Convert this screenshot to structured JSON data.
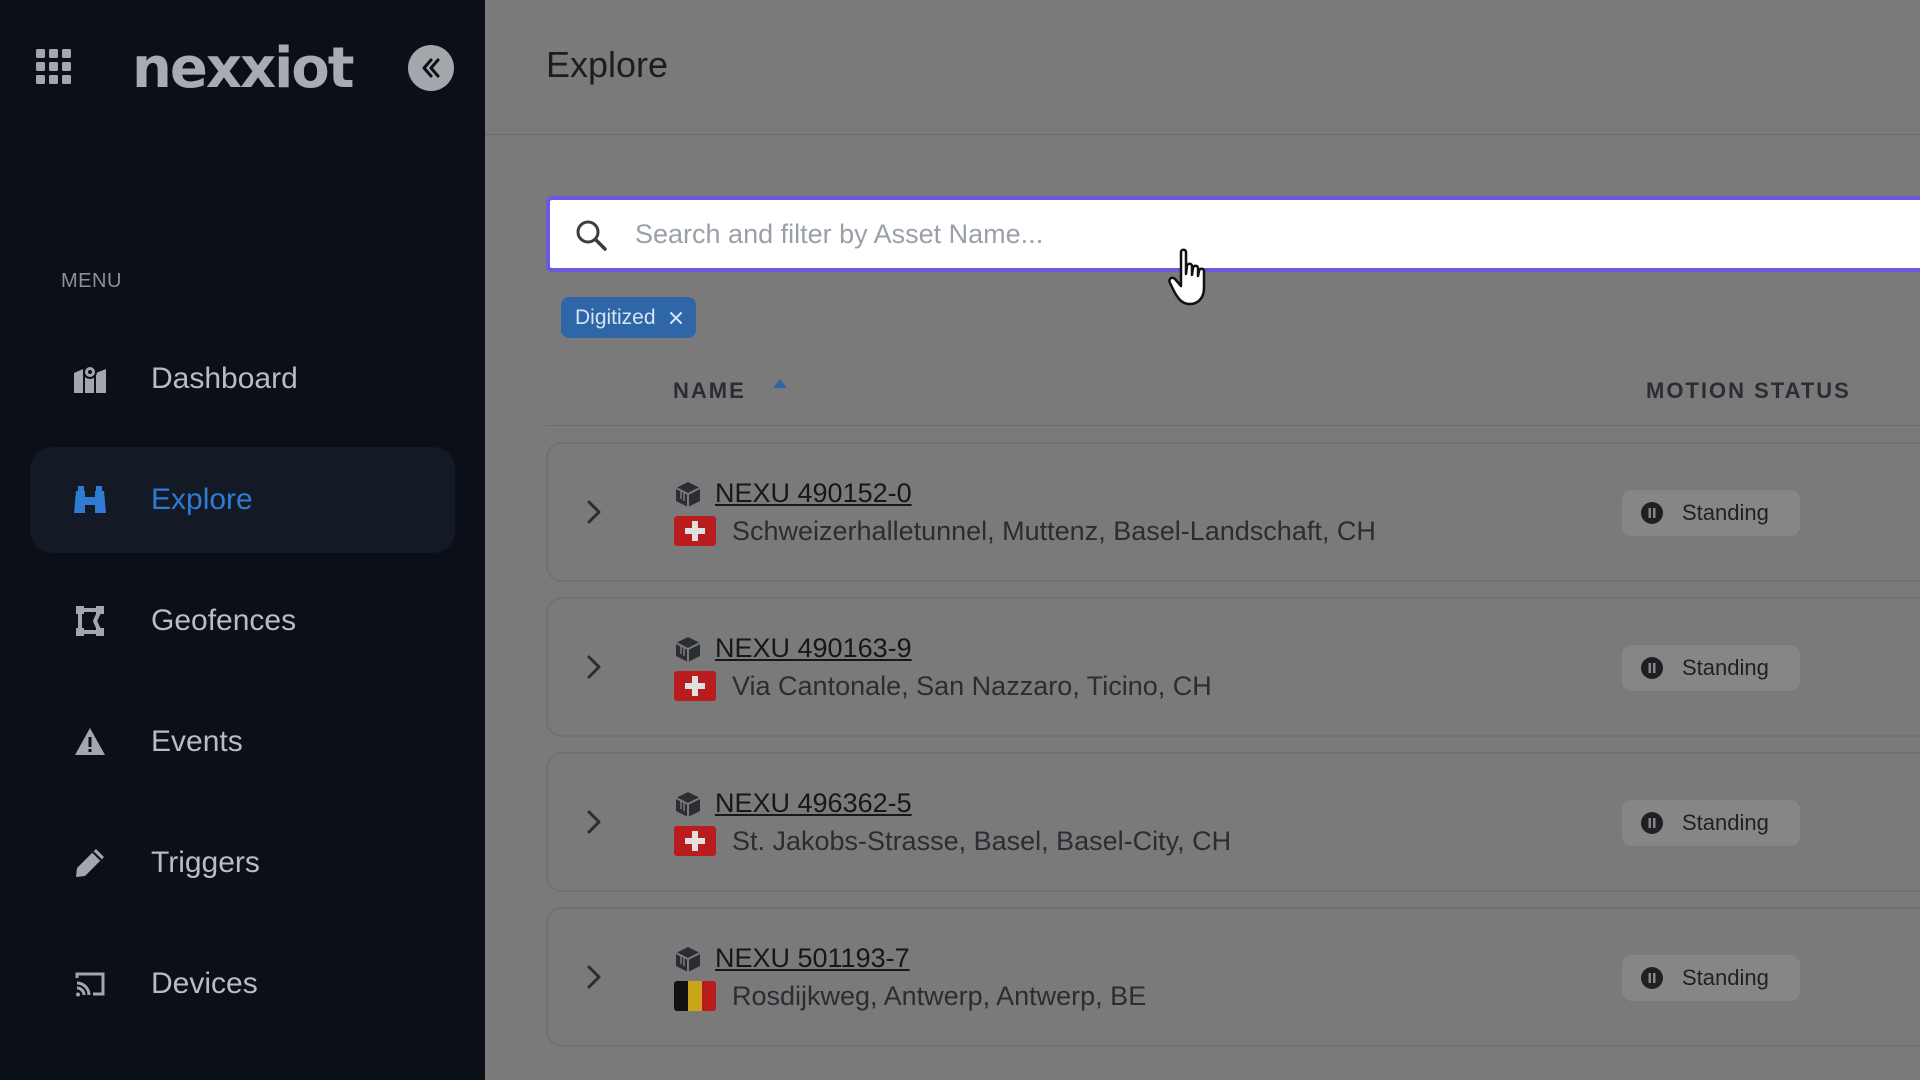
{
  "sidebar": {
    "logo_text": "nexxiot",
    "menu_label": "MENU",
    "items": [
      {
        "label": "Dashboard",
        "icon": "map-icon"
      },
      {
        "label": "Explore",
        "icon": "binoculars-icon",
        "active": true
      },
      {
        "label": "Geofences",
        "icon": "geofence-icon"
      },
      {
        "label": "Events",
        "icon": "warning-icon"
      },
      {
        "label": "Triggers",
        "icon": "pencil-icon"
      },
      {
        "label": "Devices",
        "icon": "cast-icon"
      }
    ]
  },
  "header": {
    "title": "Explore"
  },
  "search": {
    "placeholder": "Search and filter by Asset Name...",
    "value": ""
  },
  "filters": [
    {
      "label": "Digitized"
    }
  ],
  "table": {
    "columns": {
      "name": "NAME",
      "motion_status": "MOTION STATUS"
    },
    "sort": "ascending",
    "rows": [
      {
        "name": "NEXU 490152-0",
        "location": "Schweizerhalletunnel, Muttenz, Basel-Landschaft, CH",
        "country": "CH",
        "status": "Standing"
      },
      {
        "name": "NEXU 490163-9",
        "location": "Via Cantonale, San Nazzaro, Ticino, CH",
        "country": "CH",
        "status": "Standing"
      },
      {
        "name": "NEXU 496362-5",
        "location": "St. Jakobs-Strasse, Basel, Basel-City, CH",
        "country": "CH",
        "status": "Standing"
      },
      {
        "name": "NEXU 501193-7",
        "location": "Rosdijkweg, Antwerp, Antwerp, BE",
        "country": "BE",
        "status": "Standing"
      }
    ]
  },
  "colors": {
    "sidebar_bg": "#0b0f17",
    "accent": "#2f7bd4",
    "search_border": "#6a5ae0",
    "chip_bg": "#2f66a7"
  }
}
